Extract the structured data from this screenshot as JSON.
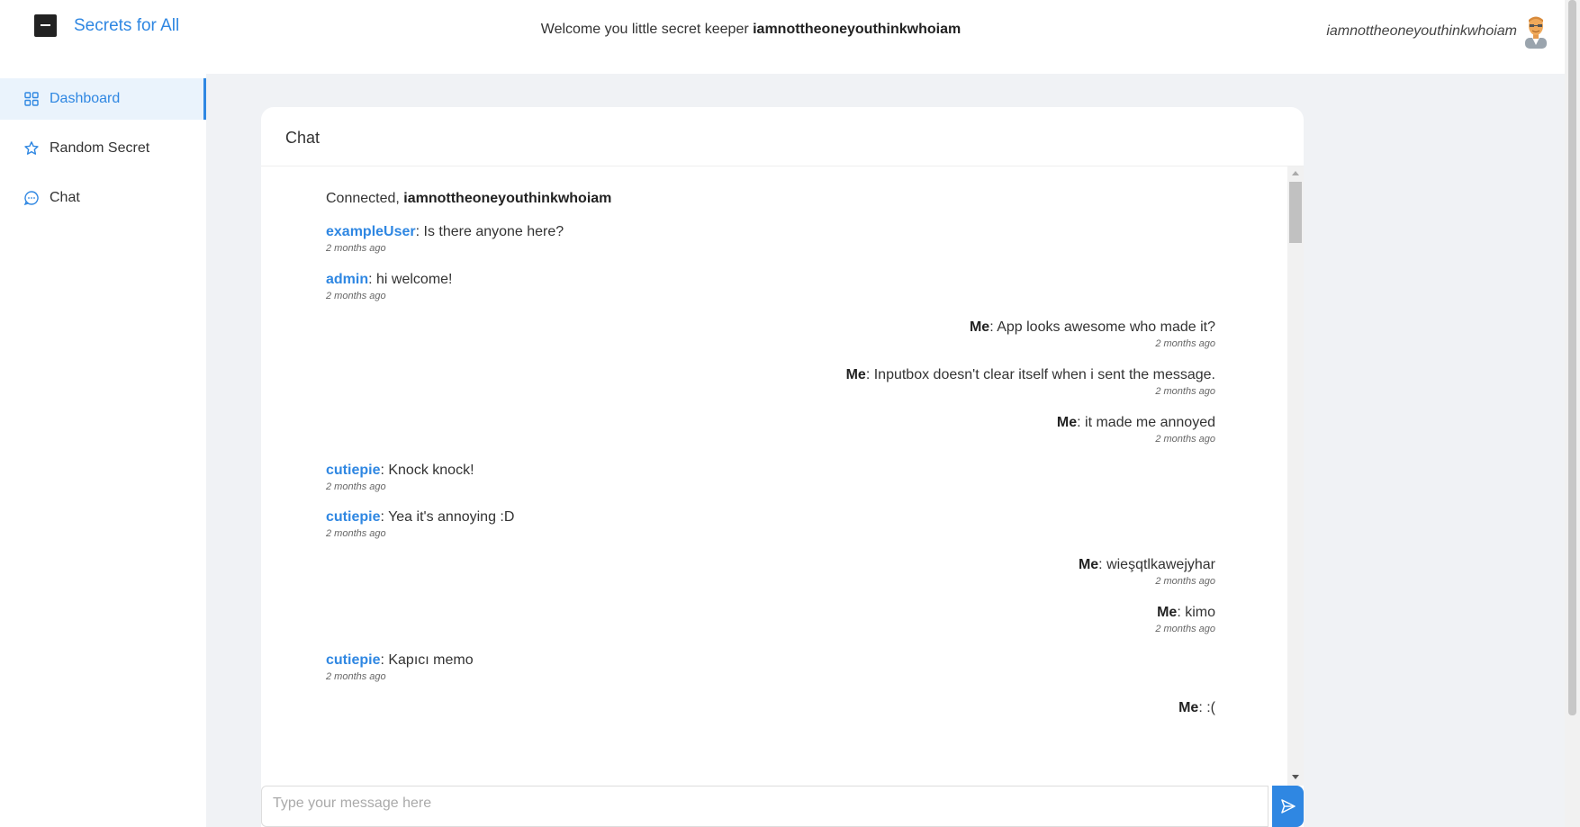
{
  "header": {
    "brand": "Secrets for All",
    "welcome_prefix": "Welcome you little secret keeper ",
    "welcome_user": "iamnottheoneyouthinkwhoiam",
    "username": "iamnottheoneyouthinkwhoiam"
  },
  "sidebar": {
    "items": [
      {
        "label": "Dashboard",
        "icon": "grid-icon",
        "active": true
      },
      {
        "label": "Random Secret",
        "icon": "star-icon",
        "active": false
      },
      {
        "label": "Chat",
        "icon": "chat-bubble-icon",
        "active": false
      }
    ]
  },
  "chat": {
    "title": "Chat",
    "connected_prefix": "Connected, ",
    "connected_user": "iamnottheoneyouthinkwhoiam",
    "messages": [
      {
        "side": "left",
        "user": "exampleUser",
        "text": ": Is there anyone here?",
        "time": "2 months ago"
      },
      {
        "side": "left",
        "user": "admin",
        "text": ": hi welcome!",
        "time": "2 months ago"
      },
      {
        "side": "right",
        "user": "Me",
        "text": ": App looks awesome who made it?",
        "time": "2 months ago"
      },
      {
        "side": "right",
        "user": "Me",
        "text": ": Inputbox doesn't clear itself when i sent the message.",
        "time": "2 months ago"
      },
      {
        "side": "right",
        "user": "Me",
        "text": ": it made me annoyed",
        "time": "2 months ago"
      },
      {
        "side": "left",
        "user": "cutiepie",
        "text": ": Knock knock!",
        "time": "2 months ago"
      },
      {
        "side": "left",
        "user": "cutiepie",
        "text": ": Yea it's annoying :D",
        "time": "2 months ago"
      },
      {
        "side": "right",
        "user": "Me",
        "text": ": wieşqtlkawejyhar",
        "time": "2 months ago"
      },
      {
        "side": "right",
        "user": "Me",
        "text": ": kimo",
        "time": "2 months ago"
      },
      {
        "side": "left",
        "user": "cutiepie",
        "text": ": Kapıcı memo",
        "time": "2 months ago"
      },
      {
        "side": "right",
        "user": "Me",
        "text": ": :(",
        "time": ""
      }
    ],
    "input_placeholder": "Type your message here",
    "send_icon": "send-icon"
  },
  "colors": {
    "accent": "#2f87e2",
    "background": "#f0f2f5",
    "active_nav_bg": "#eaf3fc"
  }
}
